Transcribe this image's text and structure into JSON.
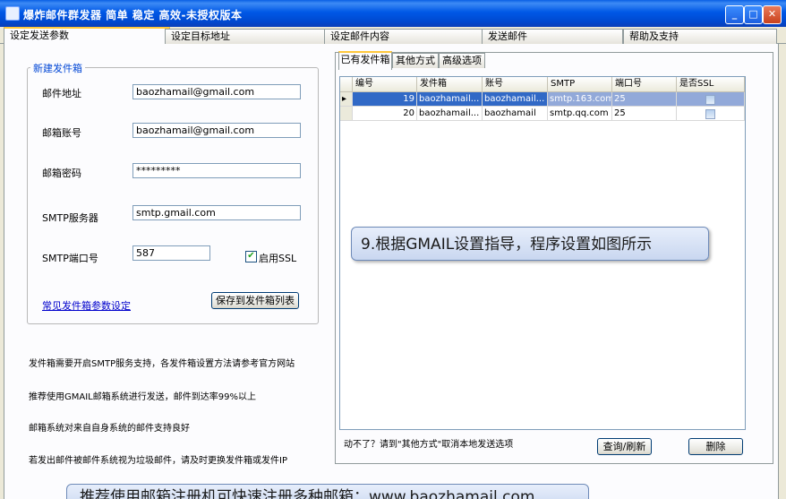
{
  "window": {
    "title": "爆炸邮件群发器  简单  稳定  高效-未授权版本"
  },
  "tabs": [
    "设定发送参数",
    "设定目标地址",
    "设定邮件内容",
    "发送邮件",
    "帮助及支持"
  ],
  "sender_group": {
    "title": "新建发件箱",
    "email_label": "邮件地址",
    "email_value": "baozhamail@gmail.com",
    "account_label": "邮箱账号",
    "account_value": "baozhamail@gmail.com",
    "password_label": "邮箱密码",
    "password_value": "*********",
    "smtp_label": "SMTP服务器",
    "smtp_value": "smtp.gmail.com",
    "port_label": "SMTP端口号",
    "port_value": "587",
    "ssl_label": "启用SSL",
    "ssl_checked": true,
    "common_link": "常见发件箱参数设定",
    "save_button": "保存到发件箱列表"
  },
  "notes": [
    "发件箱需要开启SMTP服务支持，各发件箱设置方法请参考官方网站",
    "推荐使用GMAIL邮箱系统进行发送，邮件到达率99%以上",
    "邮箱系统对来自自身系统的邮件支持良好",
    "若发出邮件被邮件系统视为垃圾邮件，请及时更换发件箱或发件IP"
  ],
  "sub_tabs": [
    "已有发件箱",
    "其他方式",
    "高级选项"
  ],
  "grid": {
    "columns": [
      "编号",
      "发件箱",
      "账号",
      "SMTP",
      "端口号",
      "是否SSL"
    ],
    "rows": [
      {
        "id": "19",
        "mailbox": "baozhamail...",
        "account": "baozhamail...",
        "smtp": "smtp.163.com",
        "port": "25",
        "ssl": false,
        "selected": true
      },
      {
        "id": "20",
        "mailbox": "baozhamail...",
        "account": "baozhamail",
        "smtp": "smtp.qq.com",
        "port": "25",
        "ssl": false,
        "selected": false
      }
    ]
  },
  "bottom_hint": "动不了？请到\"其他方式\"取消本地发送选项",
  "refresh_button": "查询/刷新",
  "delete_button": "删除",
  "callout_text": "9.根据GMAIL设置指导，程序设置如图所示",
  "bottom_callout_text": "推荐使用邮箱注册机可快速注册多种邮箱：www.baozhamail.com",
  "colors": {
    "titlebar": "#0058e6",
    "selected_row": "#3169c6",
    "link": "#0000cc",
    "group_title": "#0046d5"
  }
}
